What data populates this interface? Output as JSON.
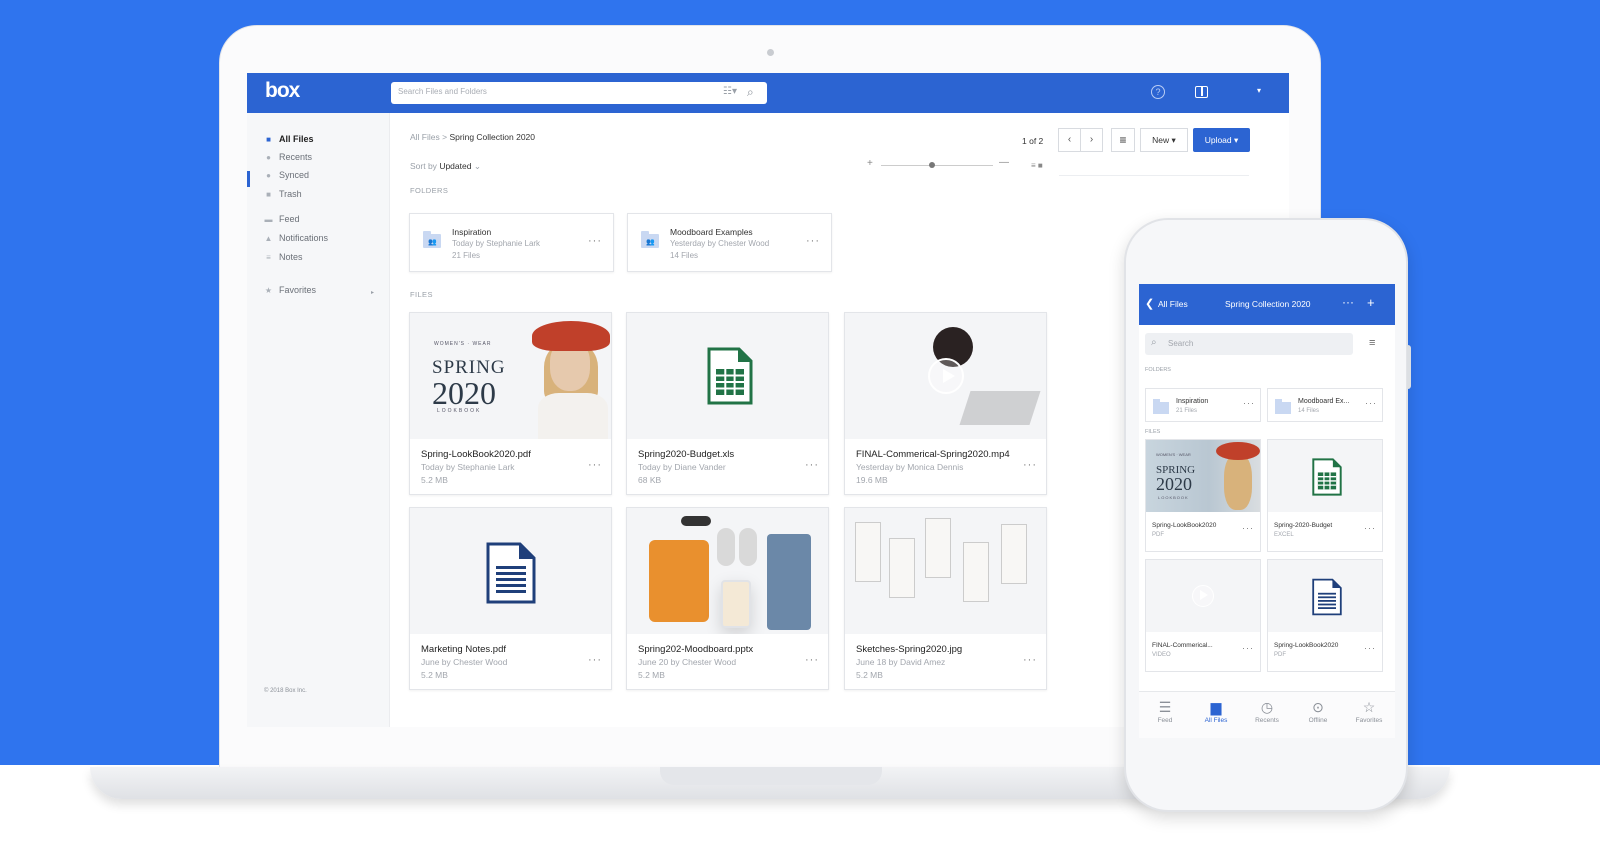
{
  "desktop": {
    "logo": "box",
    "search_placeholder": "Search Files and Folders",
    "icons": {
      "filter": "filter-icon",
      "search": "search-icon",
      "help": "help-icon",
      "panel": "panel-toggle-icon"
    },
    "sidebar": {
      "items": [
        {
          "label": "All Files",
          "icon": "folder-icon"
        },
        {
          "label": "Recents",
          "icon": "clock-icon"
        },
        {
          "label": "Synced",
          "icon": "sync-icon"
        },
        {
          "label": "Trash",
          "icon": "trash-icon"
        },
        {
          "label": "Feed",
          "icon": "feed-icon"
        },
        {
          "label": "Notifications",
          "icon": "bell-icon"
        },
        {
          "label": "Notes",
          "icon": "notes-icon"
        },
        {
          "label": "Favorites",
          "icon": "star-icon"
        }
      ],
      "copyright": "© 2018 Box Inc."
    },
    "breadcrumb": {
      "root": "All Files",
      "separator": ">",
      "current": "Spring Collection 2020"
    },
    "sort": {
      "label": "Sort by",
      "value": "Updated"
    },
    "pagination": {
      "text": "1 of 2",
      "prev": "‹",
      "next": "›"
    },
    "buttons": {
      "new": "New",
      "upload": "Upload"
    },
    "sections": {
      "folders": "FOLDERS",
      "files": "FILES"
    },
    "folders": [
      {
        "name": "Inspiration",
        "sub": "Today by Stephanie Lark",
        "count": "21 Files"
      },
      {
        "name": "Moodboard Examples",
        "sub": "Yesterday by Chester Wood",
        "count": "14 Files"
      }
    ],
    "files": [
      {
        "name": "Spring-LookBook2020.pdf",
        "sub": "Today by Stephanie Lark",
        "size": "5.2 MB"
      },
      {
        "name": "Spring2020-Budget.xls",
        "sub": "Today by Diane Vander",
        "size": "68 KB"
      },
      {
        "name": "FINAL-Commerical-Spring2020.mp4",
        "sub": "Yesterday by Monica Dennis",
        "size": "19.6 MB"
      },
      {
        "name": "Marketing Notes.pdf",
        "sub": "June by Chester Wood",
        "size": "5.2 MB"
      },
      {
        "name": "Spring202-Moodboard.pptx",
        "sub": "June 20 by Chester Wood",
        "size": "5.2 MB"
      },
      {
        "name": "Sketches-Spring2020.jpg",
        "sub": "June 18 by David Amez",
        "size": "5.2 MB"
      }
    ],
    "lookbook_cover": {
      "top": "WOMEN'S · WEAR",
      "line1": "SPRING",
      "line2": "2020",
      "bottom": "LOOKBOOK"
    }
  },
  "mobile": {
    "back_label": "All Files",
    "title": "Spring Collection 2020",
    "search_placeholder": "Search",
    "sections": {
      "folders": "FOLDERS",
      "files": "FILES"
    },
    "folders": [
      {
        "name": "Inspiration",
        "count": "21 Files"
      },
      {
        "name": "Moodboard Ex...",
        "count": "14 Files"
      }
    ],
    "files": [
      {
        "name": "Spring-LookBook2020",
        "type": "PDF"
      },
      {
        "name": "Spring-2020-Budget",
        "type": "EXCEL"
      },
      {
        "name": "FINAL-Commerical...",
        "type": "VIDEO"
      },
      {
        "name": "Spring-LookBook2020",
        "type": "PDF"
      }
    ],
    "lookbook_cover": {
      "top": "WOMEN'S · WEAR",
      "line1": "SPRING",
      "line2": "2020",
      "bottom": "LOOKBOOK"
    },
    "tabs": [
      {
        "label": "Feed",
        "icon": "feed-icon"
      },
      {
        "label": "All Files",
        "icon": "folder-icon",
        "active": true
      },
      {
        "label": "Recents",
        "icon": "clock-icon"
      },
      {
        "label": "Offline",
        "icon": "download-icon"
      },
      {
        "label": "Favorites",
        "icon": "star-icon"
      }
    ]
  },
  "colors": {
    "brand_blue": "#2c64d2",
    "background_blue": "#2f74ee",
    "sheet_green": "#217346",
    "doc_navy": "#1f3f7a"
  }
}
